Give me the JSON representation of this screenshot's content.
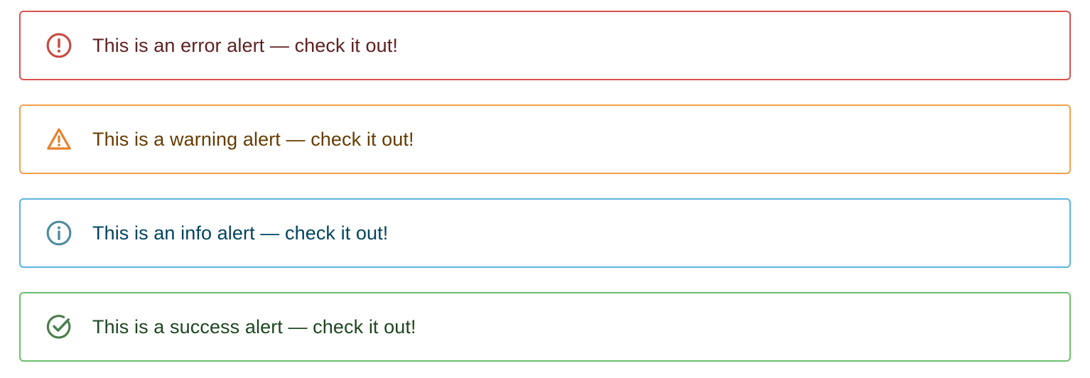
{
  "alerts": [
    {
      "severity": "error",
      "message": "This is an error alert — check it out!",
      "icon": "error-outline-icon",
      "border_color": "#d9534f",
      "icon_color": "#c94a42",
      "text_color": "#5f2120"
    },
    {
      "severity": "warning",
      "message": "This is a warning alert — check it out!",
      "icon": "warning-triangle-icon",
      "border_color": "#f0a04b",
      "icon_color": "#e8812a",
      "text_color": "#663c00"
    },
    {
      "severity": "info",
      "message": "This is an info alert — check it out!",
      "icon": "info-outline-icon",
      "border_color": "#5bb4dc",
      "icon_color": "#4e8d9e",
      "text_color": "#014361"
    },
    {
      "severity": "success",
      "message": "This is a success alert — check it out!",
      "icon": "check-circle-outline-icon",
      "border_color": "#6cbf6c",
      "icon_color": "#4a7f4a",
      "text_color": "#1e4620"
    }
  ]
}
